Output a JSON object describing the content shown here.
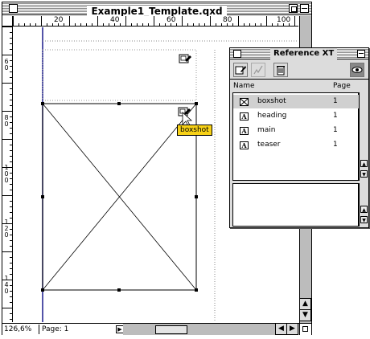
{
  "window": {
    "title": "Example1_Template.qxd"
  },
  "rulers": {
    "top_labels": [
      "20",
      "40",
      "60",
      "80",
      "100"
    ],
    "left_labels": [
      "6\n0",
      "8\n0",
      "1\n0\n0",
      "1\n2\n0",
      "1\n4\n0"
    ]
  },
  "statusbar": {
    "zoom": "126,6%",
    "page": "Page: 1"
  },
  "tooltip": {
    "text": "boxshot"
  },
  "palette": {
    "title": "Reference XT",
    "headers": {
      "name": "Name",
      "page": "Page"
    },
    "items": [
      {
        "icon": "picture-box-icon",
        "name": "boxshot",
        "page": "1",
        "selected": true
      },
      {
        "icon": "text-box-icon",
        "name": "heading",
        "page": "1",
        "selected": false
      },
      {
        "icon": "text-box-icon",
        "name": "main",
        "page": "1",
        "selected": false
      },
      {
        "icon": "text-box-icon",
        "name": "teaser",
        "page": "1",
        "selected": false
      }
    ],
    "text_icon_glyph": "A"
  },
  "colors": {
    "tooltip": "#f7d117",
    "selection": "#d0d0d0",
    "guide": "#1a1a8c"
  }
}
